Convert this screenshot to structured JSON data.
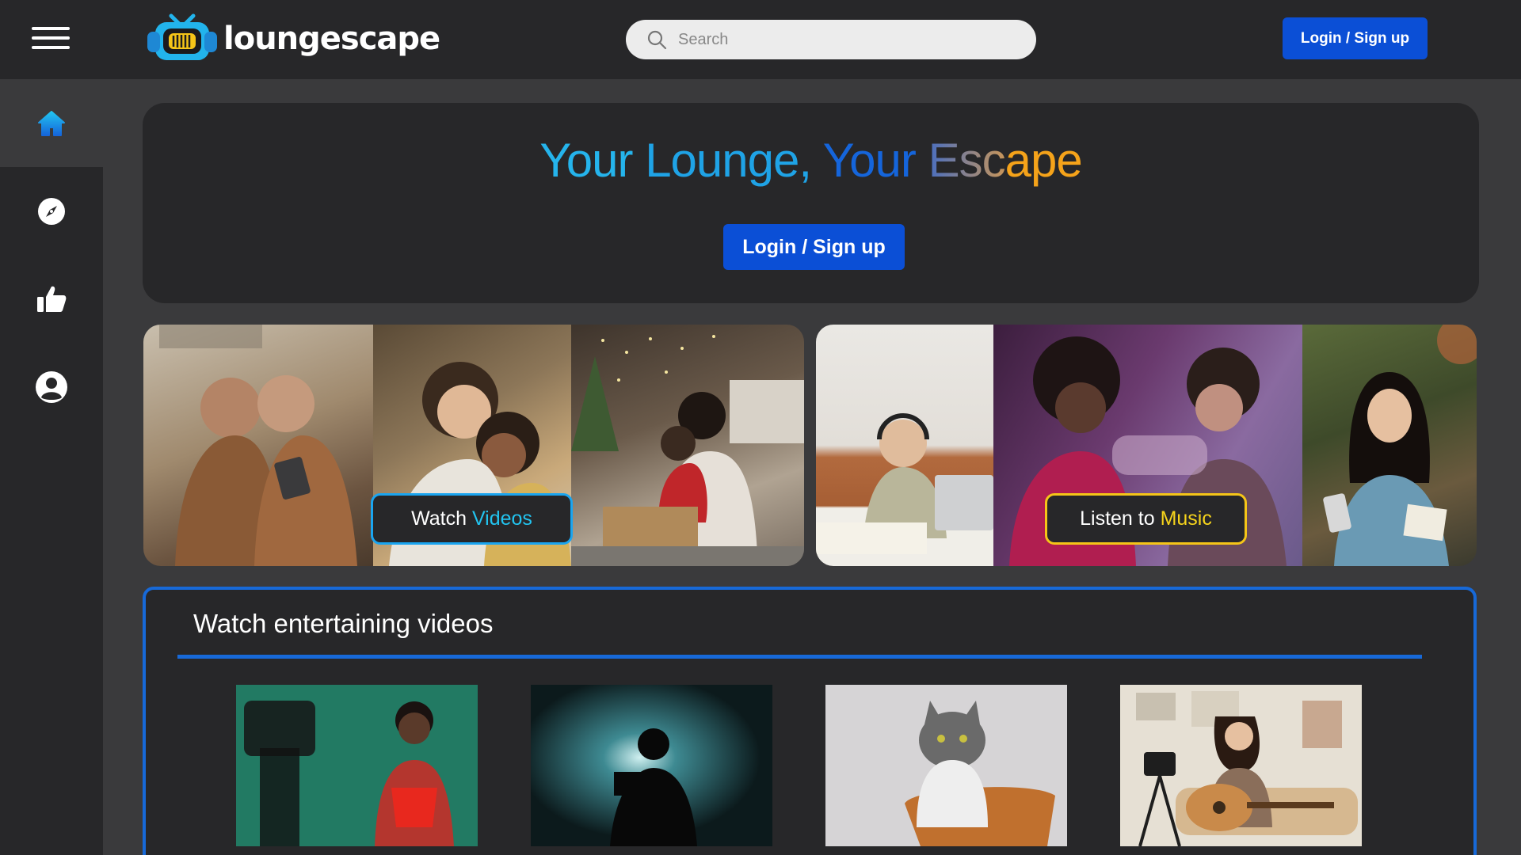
{
  "app": {
    "logo_text": "loungescape",
    "accent": "#0b4fd6"
  },
  "header": {
    "menu_icon": "hamburger-menu-icon",
    "search_placeholder": "Search",
    "search_icon": "search-icon",
    "login_label": "Login / Sign up"
  },
  "sidebar": {
    "items": [
      {
        "name": "home",
        "icon": "home-icon",
        "active": true
      },
      {
        "name": "explore",
        "icon": "compass-icon",
        "active": false
      },
      {
        "name": "liked",
        "icon": "thumbs-up-icon",
        "active": false
      },
      {
        "name": "profile",
        "icon": "user-circle-icon",
        "active": false
      }
    ]
  },
  "hero": {
    "title_parts": [
      "Your ",
      "Lounge, ",
      "Your ",
      "Esc",
      "ape"
    ],
    "title_colors": [
      "#25b4ec",
      "#1fa3e6",
      "#1565db",
      "#6c7ea8",
      "#f5a31a"
    ],
    "login_label": "Login / Sign up"
  },
  "banners": {
    "videos": {
      "label_prefix": "Watch ",
      "label_accent": "Videos"
    },
    "music": {
      "label_prefix": "Listen to ",
      "label_accent": "Music"
    }
  },
  "section": {
    "title": "Watch entertaining videos",
    "border_color": "#1769d8"
  }
}
